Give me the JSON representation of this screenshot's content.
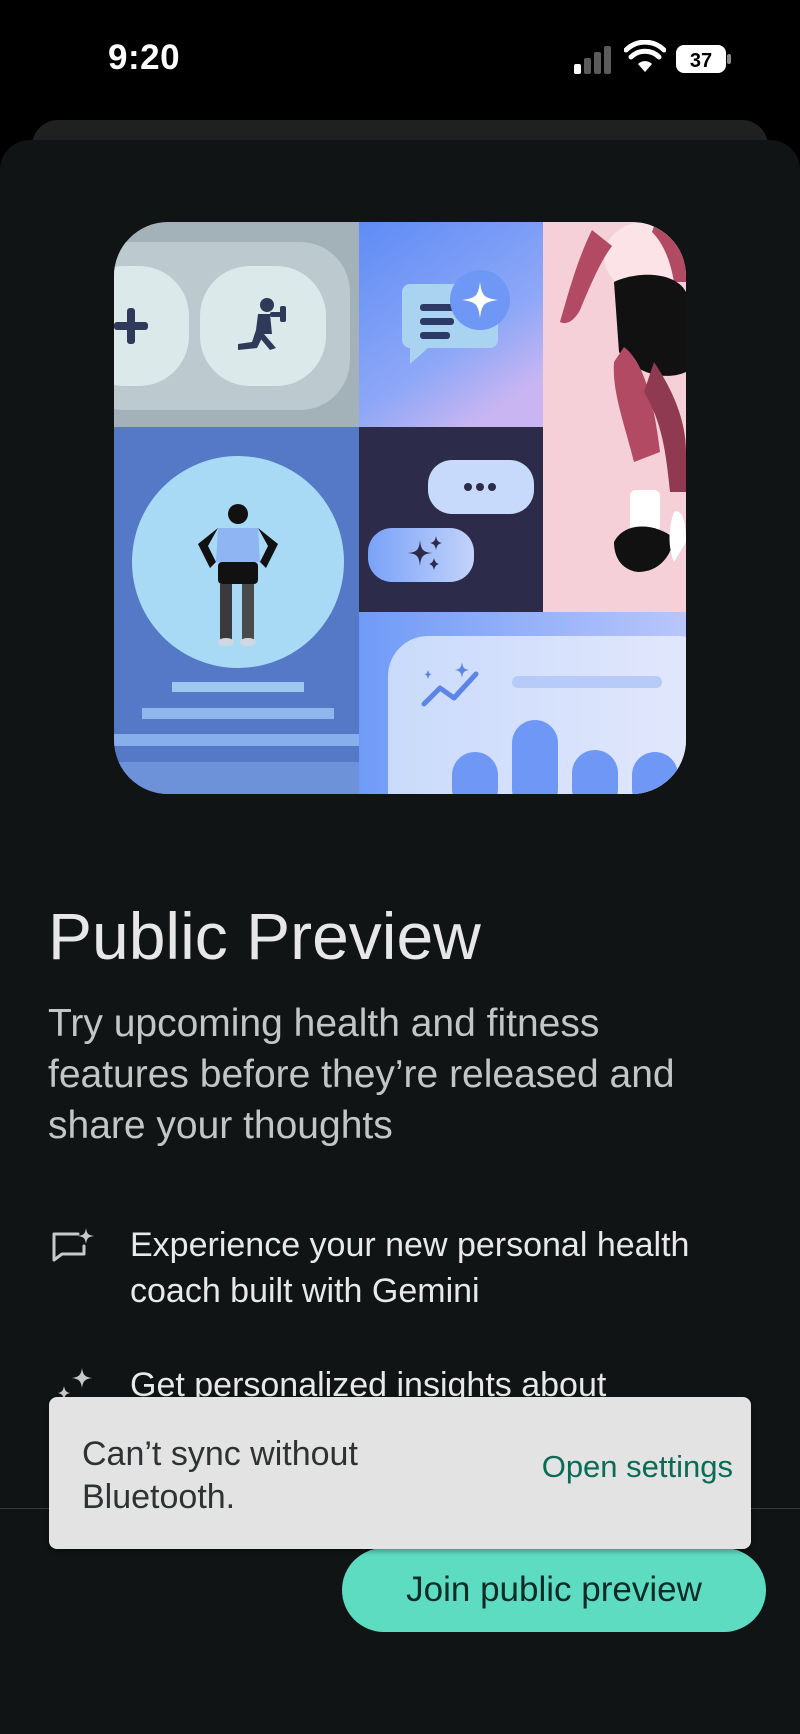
{
  "status_bar": {
    "time": "9:20",
    "battery": "37"
  },
  "hero": {
    "icons": [
      "plus-icon",
      "exercise-icon",
      "chat-sparkle-icon",
      "more-dots-icon",
      "sparkle-icon",
      "trend-icon"
    ]
  },
  "content": {
    "title": "Public Preview",
    "subtitle": "Try upcoming health and fitness features before they’re released and share your thoughts",
    "features": [
      {
        "icon": "chat-sparkle-icon",
        "text": "Experience your new personal health coach built with Gemini"
      },
      {
        "icon": "sparkle-icon",
        "text": "Get personalized insights about"
      }
    ]
  },
  "footer": {
    "join_label": "Join public preview"
  },
  "snackbar": {
    "message": "Can’t sync without Bluetooth.",
    "action_label": "Open settings"
  },
  "colors": {
    "accent": "#5edcc2",
    "sheet_background": "#111414",
    "snackbar_background": "#e2e3e2",
    "snackbar_action": "#0a6b57"
  }
}
